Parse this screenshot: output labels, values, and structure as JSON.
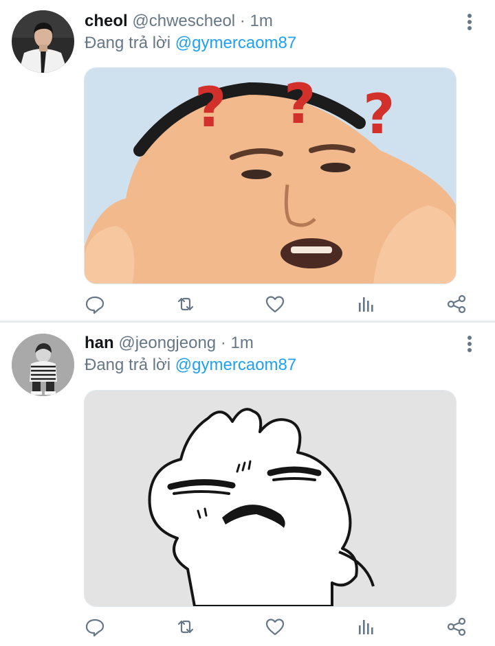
{
  "tweets": [
    {
      "author_name": "cheol",
      "handle": "@chwescheol",
      "separator": "·",
      "time": "1m",
      "reply_prefix": "Đang trả lời",
      "reply_mention": "@gymercaom87",
      "avatar_icon": "profile-photo-man-in-white-shirt",
      "media_icon": "meme-confused-face-question-marks"
    },
    {
      "author_name": "han",
      "handle": "@jeongjeong",
      "separator": "·",
      "time": "1m",
      "reply_prefix": "Đang trả lời",
      "reply_mention": "@gymercaom87",
      "avatar_icon": "profile-photo-person-sitting-grayscale",
      "media_icon": "meme-grumpy-cartoon-bunny"
    }
  ],
  "action_icons": [
    "reply-icon",
    "retweet-icon",
    "like-icon",
    "analytics-icon",
    "share-icon"
  ],
  "colors": {
    "text_primary": "#14171a",
    "text_secondary": "#657786",
    "mention": "#1da1f2",
    "icon": "#657786",
    "divider": "#e6ecf0"
  }
}
